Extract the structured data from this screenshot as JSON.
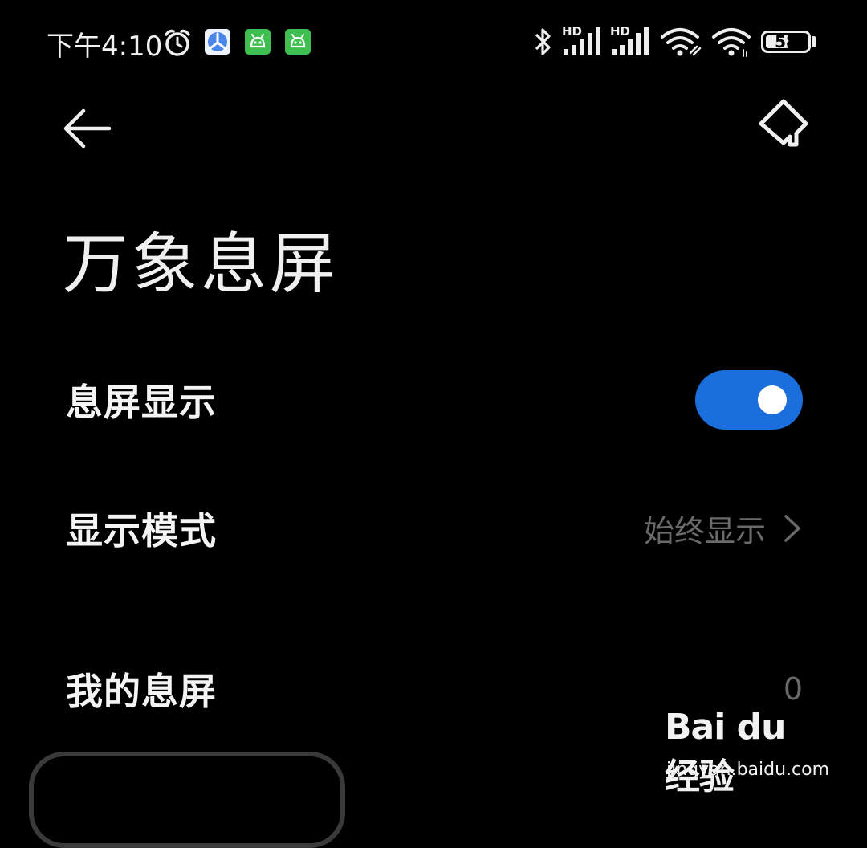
{
  "status_bar": {
    "time": "下午4:10",
    "battery_percent": 58,
    "battery_text": "58",
    "signal_1_label": "HD",
    "signal_2_label": "HD",
    "icons": [
      "alarm-icon",
      "tasks-app-icon",
      "android-app-icon",
      "android-app-icon",
      "bluetooth-icon",
      "signal-hd-icon",
      "signal-hd-icon",
      "wifi-link-icon",
      "wifi-icon",
      "battery-icon"
    ]
  },
  "header": {
    "back_icon": "arrow-left-icon",
    "action_icon": "paint-bucket-icon"
  },
  "page_title": "万象息屏",
  "settings": {
    "display_toggle": {
      "label": "息屏显示",
      "enabled": true
    },
    "display_mode": {
      "label": "显示模式",
      "value": "始终显示"
    },
    "my_aod": {
      "label": "我的息屏",
      "value": "0"
    }
  },
  "watermark": {
    "logo": "Bai du 经验",
    "url": "jingyan.baidu.com"
  },
  "colors": {
    "background": "#000000",
    "accent": "#1a6fdc",
    "secondary_text": "#6a6a6a"
  }
}
